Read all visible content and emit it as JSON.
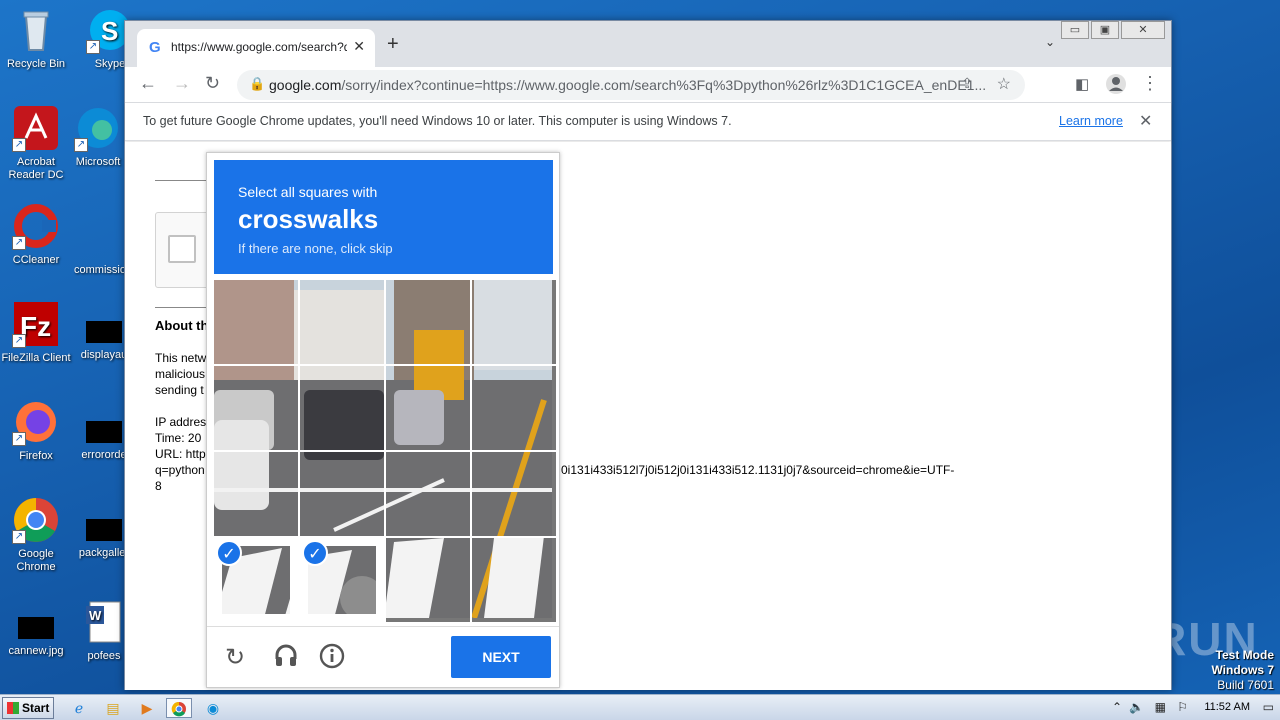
{
  "desktop": {
    "icons": [
      {
        "label": "Recycle Bin"
      },
      {
        "label": "Skype"
      },
      {
        "label": "Acrobat Reader DC"
      },
      {
        "label": "Microsoft"
      },
      {
        "label": "CCleaner"
      },
      {
        "label": "commissio"
      },
      {
        "label": "FileZilla Client"
      },
      {
        "label": "displayau"
      },
      {
        "label": "Firefox"
      },
      {
        "label": "errororde"
      },
      {
        "label": "Google Chrome"
      },
      {
        "label": "packgaller"
      },
      {
        "label": "cannew.jpg"
      },
      {
        "label": "pofees"
      }
    ],
    "watermark": "ANY RUN",
    "testmode": {
      "line1": "Test Mode",
      "line2": "Windows 7",
      "line3": "Build 7601"
    }
  },
  "browser": {
    "tab_title": "https://www.google.com/search?q=",
    "url_domain": "google.com",
    "url_rest": "/sorry/index?continue=https://www.google.com/search%3Fq%3Dpython%26rlz%3D1C1GCEA_enDE1...",
    "window_controls": {
      "min": "▭",
      "max": "▣",
      "close": "✕"
    }
  },
  "infobar": {
    "message": "To get future Google Chrome updates, you'll need Windows 10 or later. This computer is using Windows 7.",
    "learn_more": "Learn more"
  },
  "page": {
    "about_heading": "About th",
    "para_line1": "This netw",
    "para_line2": "malicious",
    "para_line3": "sending t",
    "ip_line": "IP addres",
    "time_line": "Time: 20",
    "url_line": "URL: http",
    "q_line_start": "q=python",
    "q_line_end": "0i131i433i512l7j0i512j0i131i433i512.1131j0j7&sourceid=chrome&ie=UTF-",
    "last_line": "8"
  },
  "recaptcha": {
    "instruction": "Select all squares with",
    "target": "crosswalks",
    "hint": "If there are none, click skip",
    "next_label": "NEXT",
    "tiles_selected": [
      12,
      13
    ]
  },
  "taskbar": {
    "start_label": "Start",
    "clock": "11:52 AM"
  }
}
